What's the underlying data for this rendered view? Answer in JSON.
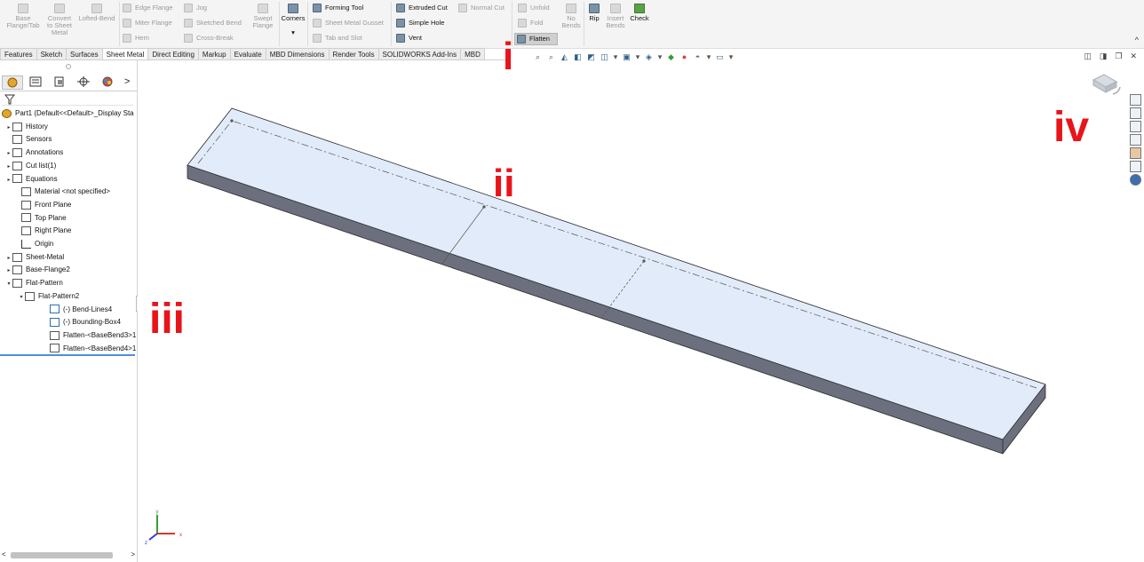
{
  "ribbon": {
    "items": [
      {
        "key": "base_flange",
        "label": "Base Flange/Tab",
        "enabled": false
      },
      {
        "key": "convert",
        "label": "Convert to Sheet Metal",
        "enabled": false
      },
      {
        "key": "lofted",
        "label": "Lofted-Bend",
        "enabled": false
      },
      {
        "key": "edge_flange",
        "label": "Edge Flange",
        "enabled": false
      },
      {
        "key": "miter_flange",
        "label": "Miter Flange",
        "enabled": false
      },
      {
        "key": "hem",
        "label": "Hem",
        "enabled": false
      },
      {
        "key": "jog",
        "label": "Jog",
        "enabled": false
      },
      {
        "key": "sketched_bend",
        "label": "Sketched Bend",
        "enabled": false
      },
      {
        "key": "cross_break",
        "label": "Cross-Break",
        "enabled": false
      },
      {
        "key": "swept_flange",
        "label": "Swept Flange",
        "enabled": false
      },
      {
        "key": "corners",
        "label": "Corners",
        "enabled": true
      },
      {
        "key": "forming_tool",
        "label": "Forming Tool",
        "enabled": true
      },
      {
        "key": "gusset",
        "label": "Sheet Metal Gusset",
        "enabled": false
      },
      {
        "key": "tab_slot",
        "label": "Tab and Slot",
        "enabled": false
      },
      {
        "key": "extruded_cut",
        "label": "Extruded Cut",
        "enabled": true
      },
      {
        "key": "simple_hole",
        "label": "Simple Hole",
        "enabled": true
      },
      {
        "key": "vent",
        "label": "Vent",
        "enabled": true
      },
      {
        "key": "normal_cut",
        "label": "Normal Cut",
        "enabled": false
      },
      {
        "key": "unfold",
        "label": "Unfold",
        "enabled": false
      },
      {
        "key": "fold",
        "label": "Fold",
        "enabled": false
      },
      {
        "key": "flatten",
        "label": "Flatten",
        "enabled": true
      },
      {
        "key": "no_bends",
        "label": "No Bends",
        "enabled": false
      },
      {
        "key": "rip",
        "label": "Rip",
        "enabled": true
      },
      {
        "key": "insert_bends",
        "label": "Insert Bends",
        "enabled": false
      },
      {
        "key": "check",
        "label": "Check",
        "enabled": true
      }
    ],
    "labels": {
      "base_flange_1": "Base",
      "base_flange_2": "Flange/Tab",
      "convert_1": "Convert",
      "convert_2": "to Sheet",
      "convert_3": "Metal",
      "lofted": "Lofted-Bend",
      "edge_flange": "Edge Flange",
      "miter_flange": "Miter Flange",
      "hem": "Hem",
      "jog": "Jog",
      "sketched_bend": "Sketched Bend",
      "cross_break": "Cross-Break",
      "swept_1": "Swept",
      "swept_2": "Flange",
      "corners": "Corners",
      "corners_caret": "▾",
      "forming_tool": "Forming Tool",
      "gusset": "Sheet Metal Gusset",
      "tab_slot": "Tab and Slot",
      "extruded_cut": "Extruded Cut",
      "simple_hole": "Simple Hole",
      "vent": "Vent",
      "normal_cut": "Normal Cut",
      "unfold": "Unfold",
      "fold": "Fold",
      "flatten": "Flatten",
      "no_bends_1": "No",
      "no_bends_2": "Bends",
      "rip": "Rip",
      "insert_1": "Insert",
      "insert_2": "Bends",
      "check": "Check",
      "collapse": "^"
    }
  },
  "tabs": [
    "Features",
    "Sketch",
    "Surfaces",
    "Sheet Metal",
    "Direct Editing",
    "Markup",
    "Evaluate",
    "MBD Dimensions",
    "Render Tools",
    "SOLIDWORKS Add-Ins",
    "MBD"
  ],
  "active_tab": "Sheet Metal",
  "pane": {
    "more": ">",
    "tree": [
      {
        "label": "Part1  (Default<<Default>_Display Sta",
        "icon": "part-icon",
        "expander": ""
      },
      {
        "label": "History",
        "icon": "history-icon",
        "expander": "▸"
      },
      {
        "label": "Sensors",
        "icon": "sensors-icon",
        "expander": ""
      },
      {
        "label": "Annotations",
        "icon": "annotations-icon",
        "expander": "▸"
      },
      {
        "label": "Cut list(1)",
        "icon": "cut-list-icon",
        "expander": "▸"
      },
      {
        "label": "Equations",
        "icon": "equations-icon",
        "expander": "▸"
      },
      {
        "label": "Material <not specified>",
        "icon": "material-icon",
        "expander": ""
      },
      {
        "label": "Front Plane",
        "icon": "plane-icon",
        "expander": ""
      },
      {
        "label": "Top Plane",
        "icon": "plane-icon",
        "expander": ""
      },
      {
        "label": "Right Plane",
        "icon": "plane-icon",
        "expander": ""
      },
      {
        "label": "Origin",
        "icon": "origin-icon",
        "expander": ""
      },
      {
        "label": "Sheet-Metal",
        "icon": "sheet-metal-icon",
        "expander": "▸"
      },
      {
        "label": "Base-Flange2",
        "icon": "base-flange-icon",
        "expander": "▸"
      },
      {
        "label": "Flat-Pattern",
        "icon": "flat-pattern-icon",
        "expander": "▾"
      },
      {
        "label": "Flat-Pattern2",
        "icon": "flat-pattern-feature-icon",
        "expander": "▾"
      },
      {
        "label": "(-) Bend-Lines4",
        "icon": "sketch-icon",
        "expander": ""
      },
      {
        "label": "(-) Bounding-Box4",
        "icon": "sketch-icon",
        "expander": ""
      },
      {
        "label": "Flatten-<BaseBend3>1",
        "icon": "flatten-bend-icon",
        "expander": ""
      },
      {
        "label": "Flatten-<BaseBend4>1",
        "icon": "flatten-bend-icon",
        "expander": ""
      }
    ],
    "scroll_left": "<",
    "scroll_right": ">"
  },
  "viewport": {
    "triad": {
      "x": "x",
      "y": "y",
      "z": "z"
    },
    "annotations": {
      "i": "i",
      "ii": "ii",
      "iii": "iii",
      "iv": "iv"
    }
  },
  "colors": {
    "face_top": "#e2ebf9",
    "face_side": "#6c6f7d",
    "edge": "#2a2a2a",
    "annotation": "#e8141b",
    "tab_active": "#ffffff"
  }
}
